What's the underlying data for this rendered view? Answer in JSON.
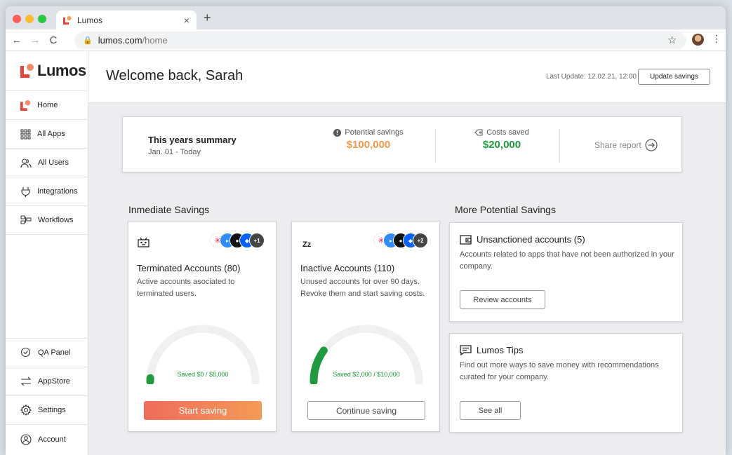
{
  "browser": {
    "tab_title": "Lumos",
    "url_host": "lumos.com",
    "url_path": "/home",
    "colors": {
      "close": "#ff5f57",
      "minimize": "#febc2e",
      "maximize": "#28c840"
    }
  },
  "sidebar": {
    "brand": "Lumos",
    "items": [
      {
        "label": "Home",
        "icon": "lumos-logo-icon"
      },
      {
        "label": "All Apps",
        "icon": "grid-icon"
      },
      {
        "label": "All Users",
        "icon": "users-icon"
      },
      {
        "label": "Integrations",
        "icon": "plug-icon"
      },
      {
        "label": "Workflows",
        "icon": "workflow-icon"
      }
    ],
    "bottom_items": [
      {
        "label": "QA Panel",
        "icon": "qa-icon"
      },
      {
        "label": "AppStore",
        "icon": "swap-icon"
      },
      {
        "label": "Settings",
        "icon": "gear-icon"
      },
      {
        "label": "Account",
        "icon": "account-icon"
      }
    ]
  },
  "header": {
    "title": "Welcome back, Sarah",
    "last_update": "Last Update: 12.02.21, 12:00",
    "update_button": "Update savings"
  },
  "summary": {
    "title": "This years summary",
    "range": "Jan. 01 - Today",
    "potential_label": "Potential savings",
    "potential_value": "$100,000",
    "saved_label": "Costs saved",
    "saved_value": "$20,000",
    "share": "Share report"
  },
  "immediate": {
    "heading": "Inmediate Savings",
    "cards": [
      {
        "icon": "robot-icon",
        "title": "Terminated Accounts (80)",
        "desc": "Active accounts asociated to terminated users.",
        "extra_apps": "+1",
        "gauge_label": "Saved $0 / $8,000",
        "progress": 0.0,
        "button": "Start saving"
      },
      {
        "icon": "sleep-icon",
        "icon_text": "Zz",
        "title": "Inactive Accounts (110)",
        "desc": "Unused accounts for over 90 days. Revoke them and start saving costs.",
        "extra_apps": "+2",
        "gauge_label": "Saved $2,000 / $10,000",
        "progress": 0.2,
        "button": "Continue saving"
      }
    ]
  },
  "more": {
    "heading": "More Potential Savings",
    "cards": [
      {
        "icon": "wallet-icon",
        "title": "Unsanctioned accounts (5)",
        "desc": "Accounts related to apps that have not been authorized in your company.",
        "button": "Review accounts"
      },
      {
        "icon": "message-icon",
        "title": "Lumos Tips",
        "desc": "Find out more ways to save money with recommendations curated for your company.",
        "button": "See all"
      }
    ]
  },
  "colors": {
    "accent": "#f05a4b",
    "potential": "#f2994a",
    "saved": "#1e9b3c",
    "gauge_track": "#f0f0f0",
    "gauge_fill": "#1f9a3c"
  }
}
